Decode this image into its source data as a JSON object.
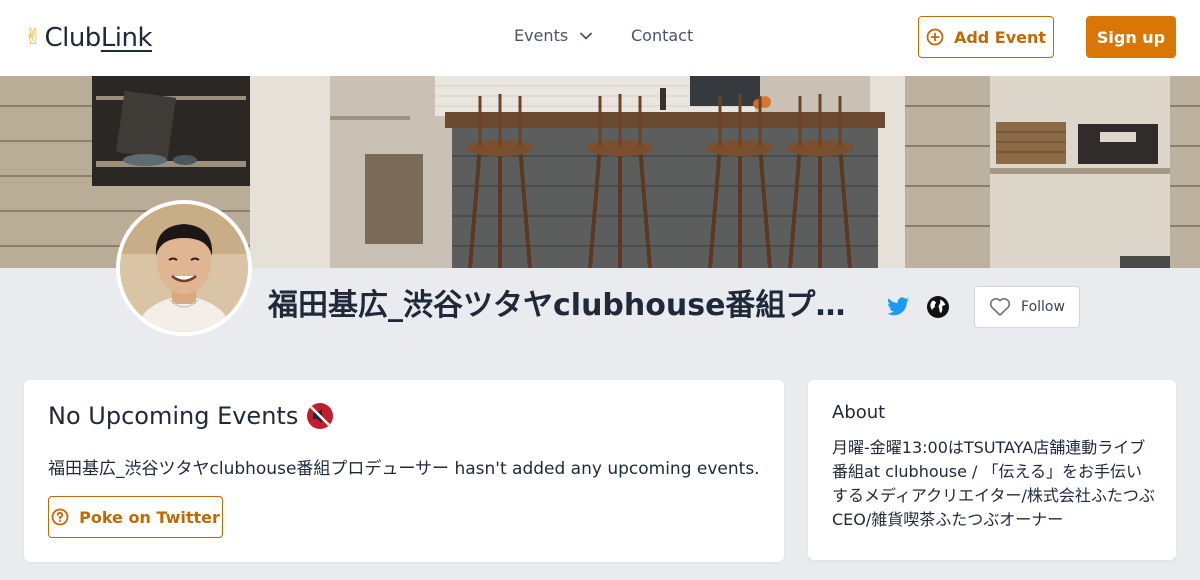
{
  "header": {
    "logo_text_a": "Club",
    "logo_text_b": "Link",
    "logo_icon": "victory-hand-icon",
    "nav_events": "Events",
    "nav_contact": "Contact",
    "add_event": "Add Event",
    "sign_up": "Sign up"
  },
  "profile": {
    "name": "福田基広_渋谷ツタヤclubhouse番組プロデューサー",
    "twitter_icon": "twitter-icon",
    "website_icon": "globe-icon",
    "follow_label": "Follow",
    "follow_icon": "heart-icon"
  },
  "events": {
    "title": "No Upcoming Events",
    "title_icon": "muted-speaker-icon",
    "message": "福田基広_渋谷ツタヤclubhouse番組プロデューサー hasn't added any upcoming events.",
    "poke_label": "Poke on Twitter",
    "poke_icon": "question-circle-icon"
  },
  "about": {
    "title": "About",
    "text": "月曜-金曜13:00はTSUTAYA店舗連動ライブ番組at clubhouse / 「伝える」をお手伝いするメディアクリエイター/株式会社ふたつぶCEO/雑貨喫茶ふたつぶオーナー"
  },
  "colors": {
    "accent": "#d97706",
    "accent_border": "#c06a00",
    "twitter": "#1d9bf0",
    "background": "#e9ebee"
  }
}
